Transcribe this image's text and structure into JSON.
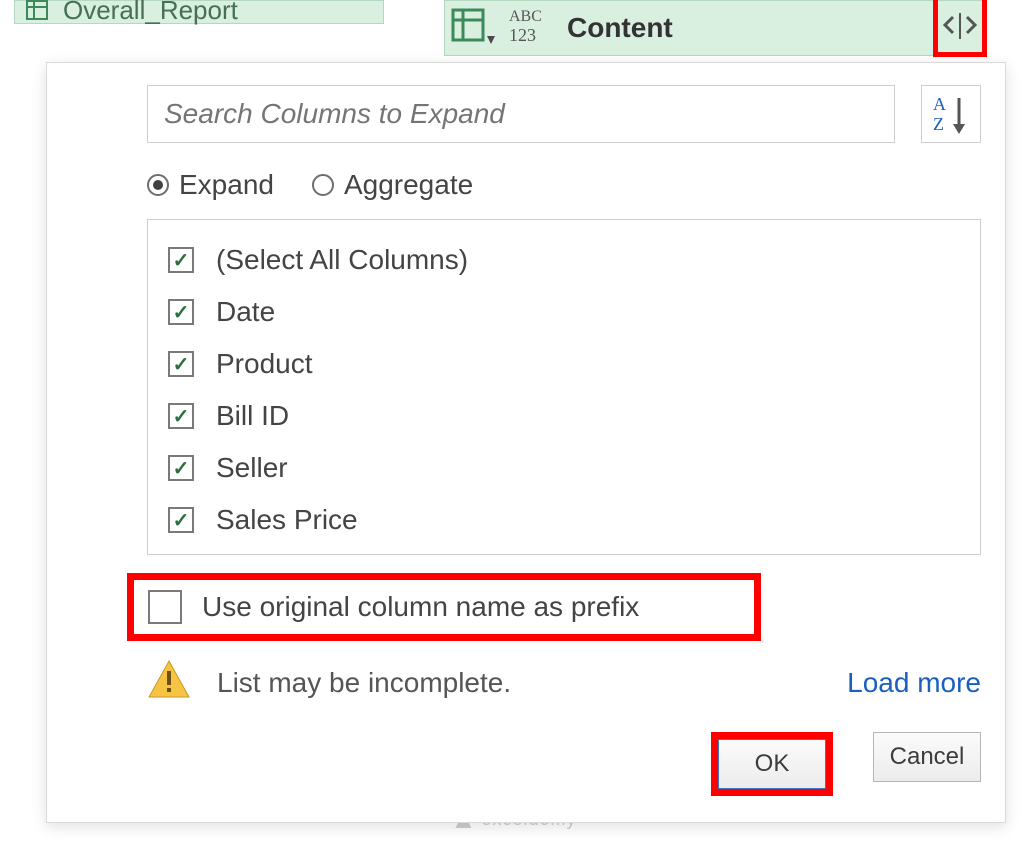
{
  "query_tab": {
    "name": "Overall_Report"
  },
  "column_header": {
    "title": "Content",
    "type_label": "ABC 123"
  },
  "search": {
    "placeholder": "Search Columns to Expand"
  },
  "radios": {
    "expand": "Expand",
    "aggregate": "Aggregate",
    "selected": "expand"
  },
  "columns": {
    "select_all": "(Select All Columns)",
    "items": [
      "Date",
      "Product",
      "Bill ID",
      "Seller",
      "Sales Price"
    ]
  },
  "prefix": {
    "label": "Use original column name as prefix",
    "checked": false
  },
  "warning": {
    "text": "List may be incomplete.",
    "load_more": "Load more"
  },
  "buttons": {
    "ok": "OK",
    "cancel": "Cancel"
  },
  "watermark": "exceldemy"
}
